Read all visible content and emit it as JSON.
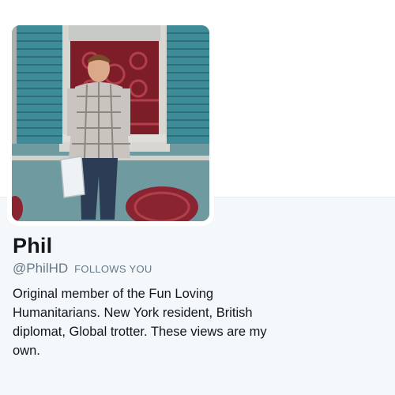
{
  "profile": {
    "name": "Phil",
    "handle": "@PhilHD",
    "follows_you": "FOLLOWS YOU",
    "bio": "Original member of the Fun Loving Humanitarians. New York resident, British diplomat, Global trotter. These views are my own."
  },
  "colors": {
    "text_primary": "#14171a",
    "text_secondary": "#657786",
    "background": "#f5f8fa",
    "shutter": "#3e8c98",
    "grate": "#8b2431"
  }
}
